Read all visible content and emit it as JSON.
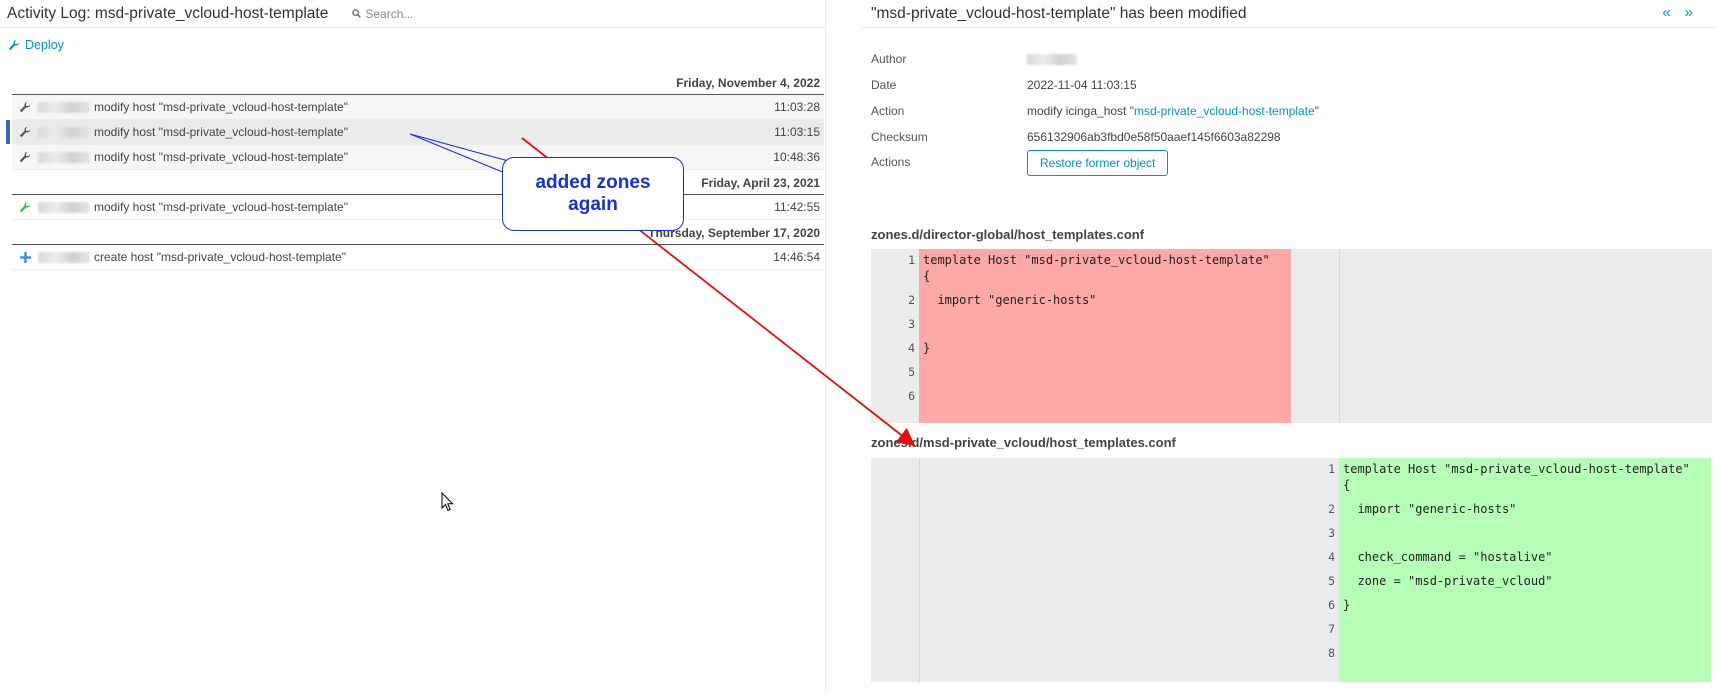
{
  "left": {
    "title": "Activity Log: msd-private_vcloud-host-template",
    "search_placeholder": "Search...",
    "deploy_label": "Deploy",
    "days": [
      {
        "date": "Friday, November 4, 2022",
        "rows": [
          {
            "icon": "wrench-icon",
            "message": "modify host \"msd-private_vcloud-host-template\"",
            "time": "11:03:28"
          },
          {
            "icon": "wrench-icon",
            "message": "modify host \"msd-private_vcloud-host-template\"",
            "time": "11:03:15"
          },
          {
            "icon": "wrench-icon",
            "message": "modify host \"msd-private_vcloud-host-template\"",
            "time": "10:48:36"
          }
        ]
      },
      {
        "date": "Friday, April 23, 2021",
        "rows": [
          {
            "icon": "wrench-green-icon",
            "message": "modify host \"msd-private_vcloud-host-template\"",
            "time": "11:42:55"
          }
        ]
      },
      {
        "date": "Thursday, September 17, 2020",
        "rows": [
          {
            "icon": "plus-icon",
            "message": "create host \"msd-private_vcloud-host-template\"",
            "time": "14:46:54"
          }
        ]
      }
    ]
  },
  "annotation": {
    "text_line1": "added zones",
    "text_line2": "again",
    "color": "#1a2fd0",
    "arrow_color": "#e01010"
  },
  "right": {
    "title": "\"msd-private_vcloud-host-template\" has been modified",
    "nav_prev": "«",
    "nav_next": "»",
    "props": {
      "author_label": "Author",
      "date_label": "Date",
      "date": "2022-11-04 11:03:15",
      "action_label": "Action",
      "action_prefix": "modify icinga_host \"",
      "action_link": "msd-private_vcloud-host-template",
      "action_suffix": "\"",
      "checksum_label": "Checksum",
      "checksum": "656132906ab3fbd0e58f50aaef145f6603a82298",
      "actions_label": "Actions",
      "restore_label": "Restore former object"
    },
    "file1": {
      "path": "zones.d/director-global/host_templates.conf",
      "line_numbers": [
        "1",
        "2",
        "3",
        "4",
        "5",
        "6"
      ],
      "lines": [
        "template Host \"msd-private_vcloud-host-template\"",
        "{",
        "  import \"generic-hosts\"",
        "",
        "}",
        "",
        ""
      ],
      "bg": "#ffa8a8"
    },
    "file2": {
      "path": "zones.d/msd-private_vcloud/host_templates.conf",
      "line_numbers": [
        "1",
        "2",
        "3",
        "4",
        "5",
        "6",
        "7",
        "8"
      ],
      "lines": [
        "template Host \"msd-private_vcloud-host-template\"",
        "{",
        "  import \"generic-hosts\"",
        "",
        "  check_command = \"hostalive\"",
        "  zone = \"msd-private_vcloud\"",
        "}",
        "",
        ""
      ],
      "bg": "#b6ffb6"
    }
  }
}
